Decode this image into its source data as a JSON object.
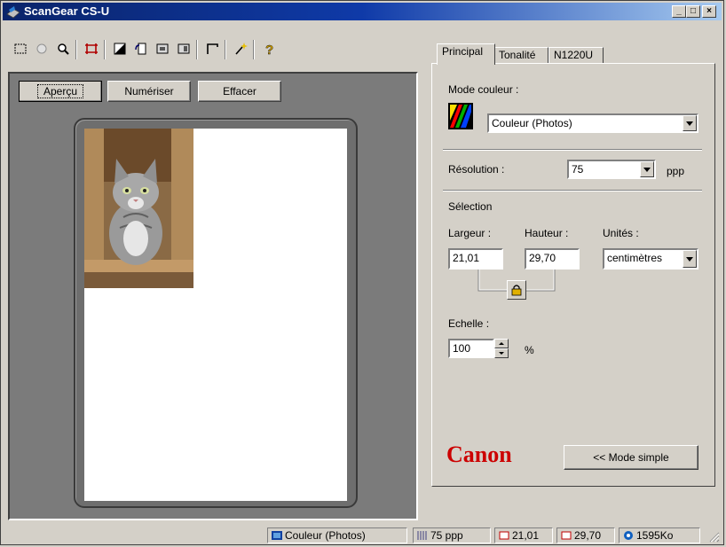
{
  "window": {
    "title": "ScanGear CS-U",
    "minimize": "_",
    "maximize": "□",
    "close": "×"
  },
  "preview": {
    "buttons": {
      "apercu": "Aperçu",
      "numeriser": "Numériser",
      "effacer": "Effacer"
    }
  },
  "tabs": [
    {
      "label": "Principal",
      "active": true
    },
    {
      "label": "Tonalité"
    },
    {
      "label": "N1220U"
    }
  ],
  "main": {
    "color_mode_label": "Mode couleur :",
    "color_mode_value": "Couleur (Photos)",
    "resolution_label": "Résolution :",
    "resolution_value": "75",
    "resolution_unit": "ppp",
    "selection_label": "Sélection",
    "width_label": "Largeur :",
    "width_value": "21,01",
    "height_label": "Hauteur :",
    "height_value": "29,70",
    "units_label": "Unités :",
    "units_value": "centimètres",
    "scale_label": "Echelle :",
    "scale_value": "100",
    "scale_unit": "%",
    "brand": "Canon",
    "mode_button": "<< Mode simple"
  },
  "statusbar": {
    "color_mode": "Couleur (Photos)",
    "resolution": "75 ppp",
    "width": "21,01",
    "height": "29,70",
    "size": "1595Ko"
  },
  "colors": {
    "titlebar": "#0a246a",
    "canon_red": "#cc0000",
    "face": "#d4d0c8"
  }
}
